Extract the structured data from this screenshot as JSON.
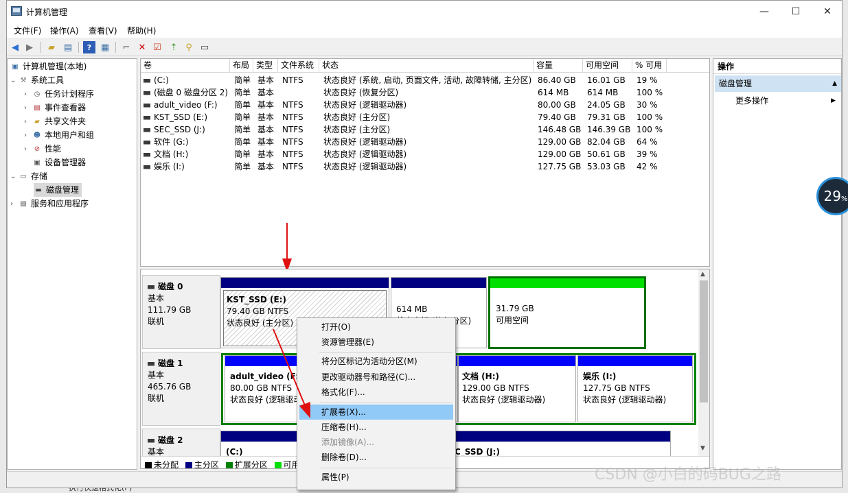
{
  "window": {
    "title": "计算机管理"
  },
  "menu": [
    "文件(F)",
    "操作(A)",
    "查看(V)",
    "帮助(H)"
  ],
  "tree": {
    "root": "计算机管理(本地)",
    "system_tools": "系统工具",
    "task_scheduler": "任务计划程序",
    "event_viewer": "事件查看器",
    "shared_folders": "共享文件夹",
    "local_users": "本地用户和组",
    "performance": "性能",
    "device_manager": "设备管理器",
    "storage": "存储",
    "disk_management": "磁盘管理",
    "services_apps": "服务和应用程序"
  },
  "volume_table": {
    "headers": [
      "卷",
      "布局",
      "类型",
      "文件系统",
      "状态",
      "容量",
      "可用空间",
      "% 可用"
    ],
    "rows": [
      [
        "(C:)",
        "简单",
        "基本",
        "NTFS",
        "状态良好 (系统, 启动, 页面文件, 活动, 故障转储, 主分区)",
        "86.40 GB",
        "16.01 GB",
        "19 %"
      ],
      [
        "(磁盘 0 磁盘分区 2)",
        "简单",
        "基本",
        "",
        "状态良好 (恢复分区)",
        "614 MB",
        "614 MB",
        "100 %"
      ],
      [
        "adult_video (F:)",
        "简单",
        "基本",
        "NTFS",
        "状态良好 (逻辑驱动器)",
        "80.00 GB",
        "24.05 GB",
        "30 %"
      ],
      [
        "KST_SSD (E:)",
        "简单",
        "基本",
        "NTFS",
        "状态良好 (主分区)",
        "79.40 GB",
        "79.31 GB",
        "100 %"
      ],
      [
        "SEC_SSD (J:)",
        "简单",
        "基本",
        "NTFS",
        "状态良好 (主分区)",
        "146.48 GB",
        "146.39 GB",
        "100 %"
      ],
      [
        "软件 (G:)",
        "简单",
        "基本",
        "NTFS",
        "状态良好 (逻辑驱动器)",
        "129.00 GB",
        "82.04 GB",
        "64 %"
      ],
      [
        "文档 (H:)",
        "简单",
        "基本",
        "NTFS",
        "状态良好 (逻辑驱动器)",
        "129.00 GB",
        "50.61 GB",
        "39 %"
      ],
      [
        "娱乐 (I:)",
        "简单",
        "基本",
        "NTFS",
        "状态良好 (逻辑驱动器)",
        "127.75 GB",
        "53.03 GB",
        "42 %"
      ]
    ]
  },
  "disks": {
    "disk0": {
      "name": "磁盘 0",
      "type": "基本",
      "size": "111.79 GB",
      "state": "联机",
      "p1": {
        "name": "KST_SSD  (E:)",
        "line2": "79.40 GB NTFS",
        "line3": "状态良好 (主分区)"
      },
      "p2": {
        "line2": "614 MB",
        "line3": "状态良好 (恢复分区)"
      },
      "p3": {
        "line2": "31.79 GB",
        "line3": "可用空间"
      }
    },
    "disk1": {
      "name": "磁盘 1",
      "type": "基本",
      "size": "465.76 GB",
      "state": "联机",
      "p1": {
        "name": "adult_video  (F:)",
        "line2": "80.00 GB NTFS",
        "line3": "状态良好 (逻辑驱动器)"
      },
      "p2": {
        "name": "文档  (H:)",
        "line2": "129.00 GB NTFS",
        "line3": "状态良好 (逻辑驱动器)"
      },
      "p3": {
        "name": "娱乐  (I:)",
        "line2": "127.75 GB NTFS",
        "line3": "状态良好 (逻辑驱动器)"
      }
    },
    "disk2": {
      "name": "磁盘 2",
      "type": "基本",
      "p1": {
        "name": "(C:)"
      },
      "p2": {
        "name": "C_SSD  (J:)"
      }
    }
  },
  "legend": {
    "unallocated": "未分配",
    "primary": "主分区",
    "extended": "扩展分区",
    "free": "可用空间",
    "colors": {
      "unallocated": "#000000",
      "primary": "#000080",
      "extended": "#008000",
      "free": "#00e000",
      "logical": "#0000ff"
    }
  },
  "actions": {
    "header": "操作",
    "section": "磁盘管理",
    "more": "更多操作"
  },
  "context_menu": {
    "open": "打开(O)",
    "explorer": "资源管理器(E)",
    "mark_active": "将分区标记为活动分区(M)",
    "change_letter": "更改驱动器号和路径(C)...",
    "format": "格式化(F)...",
    "extend": "扩展卷(X)...",
    "shrink": "压缩卷(H)...",
    "add_mirror": "添加镜像(A)...",
    "delete": "删除卷(D)...",
    "properties": "属性(P)"
  },
  "overlay": {
    "cpu_percent": "29",
    "percent_sign": "%",
    "watermark": "CSDN @小白的码BUG之路",
    "bottom_text": "执行快速格式化(P)"
  }
}
